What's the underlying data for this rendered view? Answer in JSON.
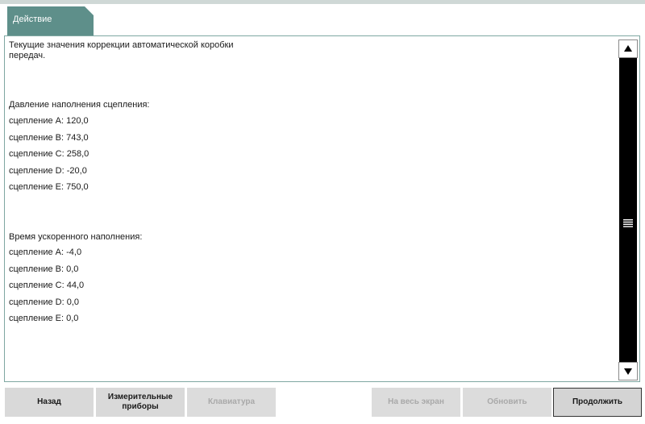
{
  "tab": {
    "label": "Действие"
  },
  "content": {
    "intro": "Текущие значения коррекции автоматической коробки передач.",
    "pressure_heading": "Давление наполнения сцепления:",
    "pressure_items": [
      "сцепление A: 120,0",
      "сцепление B: 743,0",
      "сцепление C: 258,0",
      "сцепление D: -20,0",
      "сцепление E: 750,0"
    ],
    "fast_fill_heading": "Время ускоренного наполнения:",
    "fast_fill_items": [
      "сцепление A: -4,0",
      "сцепление B: 0,0",
      "сцепление C: 44,0",
      "сцепление D: 0,0",
      "сцепление E: 0,0"
    ]
  },
  "buttons": {
    "back": "Назад",
    "instruments": "Измерительные приборы",
    "keyboard": "Клавиатура",
    "fullscreen": "На весь экран",
    "refresh": "Обновить",
    "continue": "Продолжить"
  },
  "icons": {
    "scroll_up": "triangle-up-icon",
    "scroll_down": "triangle-down-icon",
    "scroll_grip": "grip-lines-icon"
  }
}
